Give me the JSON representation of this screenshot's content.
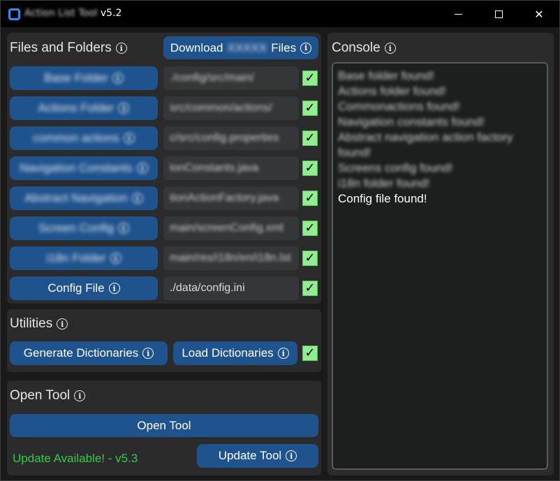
{
  "window": {
    "title": "Action List Tool",
    "version": "v5.2",
    "minimize_glyph": "",
    "maximize_glyph": "",
    "close_glyph": "✕"
  },
  "files": {
    "title": "Files and Folders",
    "download_prefix": "Download",
    "download_blurred": "XXXXX",
    "download_suffix": "Files",
    "rows": [
      {
        "label": "Base Folder",
        "path": "./config/src/main/",
        "checked": true
      },
      {
        "label": "Actions Folder",
        "path": "src/common/actions/",
        "checked": true
      },
      {
        "label": "common actions",
        "path": "c/src/config.properties",
        "checked": true
      },
      {
        "label": "Navigation Constants",
        "path": "ionConstants.java",
        "checked": true
      },
      {
        "label": "Abstract Navigation",
        "path": "tionActionFactory.java",
        "checked": true
      },
      {
        "label": "Screen Config",
        "path": "main/screenConfig.xml",
        "checked": true
      },
      {
        "label": "i18n Folder",
        "path": "main/res/i18n/en/i18n.lst",
        "checked": true
      },
      {
        "label": "Config File",
        "path": "./data/config.ini",
        "checked": true
      }
    ]
  },
  "utilities": {
    "title": "Utilities",
    "generate_label": "Generate Dictionaries",
    "load_label": "Load Dictionaries",
    "load_checked": true
  },
  "open_tool": {
    "title": "Open Tool",
    "open_label": "Open Tool",
    "update_status": "Update Available! - v5.3",
    "update_label": "Update Tool"
  },
  "console": {
    "title": "Console",
    "lines": [
      {
        "text": "Base folder found!",
        "blurred": true
      },
      {
        "text": "Actions folder found!",
        "blurred": true
      },
      {
        "text": "Commonactions found!",
        "blurred": true
      },
      {
        "text": "Navigation constants found!",
        "blurred": true
      },
      {
        "text": "Abstract navigation action factory found!",
        "blurred": true
      },
      {
        "text": "Screens config found!",
        "blurred": true
      },
      {
        "text": "i18n folder found!",
        "blurred": true
      },
      {
        "text": "Config file found!",
        "blurred": false
      }
    ]
  },
  "colors": {
    "accent_button": "#1f538d",
    "check_green": "#90ee90",
    "update_green": "#2fcc4a",
    "panel": "#2b2b2b",
    "background": "#1a1a1a"
  },
  "icons": [
    "app-icon",
    "info-icon",
    "checkmark-icon",
    "minimize-icon",
    "maximize-icon",
    "close-icon"
  ]
}
